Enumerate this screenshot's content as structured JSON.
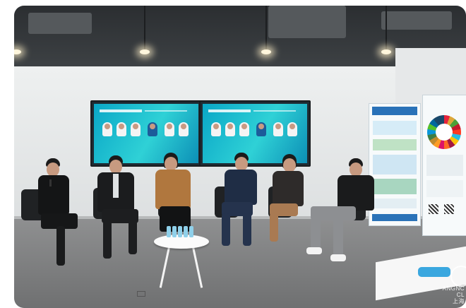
{
  "scene": {
    "panelists": [
      {
        "name": "speaker-with-microphone"
      },
      {
        "name": "man-dark-suit"
      },
      {
        "name": "woman-tan-blazer"
      },
      {
        "name": "man-navy-shirt"
      },
      {
        "name": "woman-dark-top"
      },
      {
        "name": "man-black-tshirt"
      }
    ],
    "colors": {
      "screen_teal": "#2fd1d6",
      "banner_blue": "#2a72b8",
      "floor_gray": "#7f8081"
    }
  },
  "watermark": {
    "line1": "ANGNC",
    "line2": "CL",
    "line3": "上海"
  }
}
